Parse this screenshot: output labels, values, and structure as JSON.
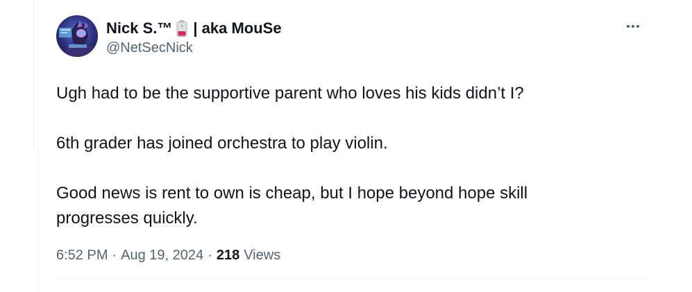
{
  "author": {
    "display_name": "Nick S.™",
    "name_suffix": "| aka MouSe",
    "handle": "@NetSecNick",
    "avatar_icon": "avatar-hooded-mouse-icon",
    "emoji_icon": "battery-low-emoji-icon"
  },
  "tweet": {
    "paragraphs": [
      "Ugh had to be the supportive parent who loves his kids didn’t I?",
      "6th grader has joined orchestra to play violin.",
      "Good news is rent to own is cheap, but I hope beyond hope skill progresses quickly."
    ],
    "time": "6:52 PM",
    "date": "Aug 19, 2024",
    "views_count": "218",
    "views_label": "Views",
    "separator": "·"
  },
  "menu": {
    "more_icon": "more-horizontal-icon"
  },
  "colors": {
    "text_primary": "#0f1419",
    "text_secondary": "#536471",
    "divider": "#eff3f4"
  }
}
